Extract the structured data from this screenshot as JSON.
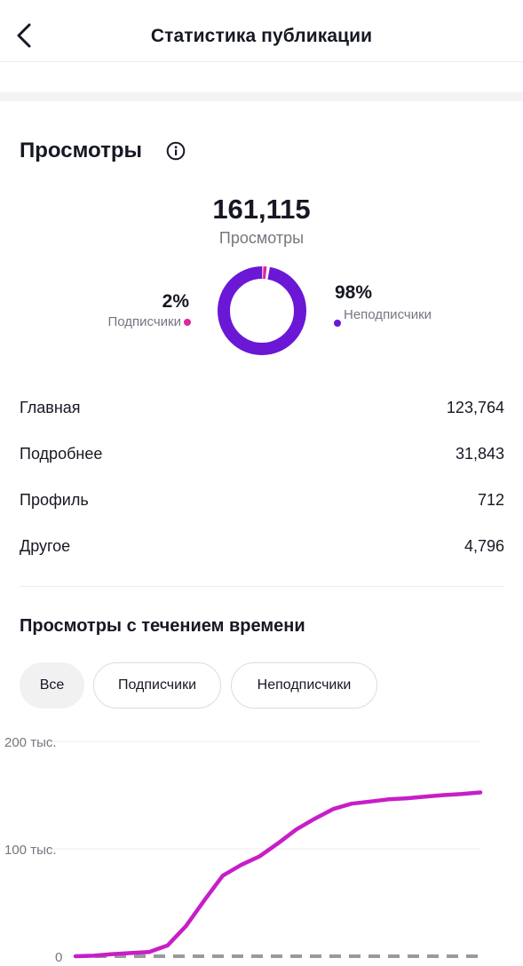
{
  "header": {
    "title": "Статистика публикации"
  },
  "views": {
    "title": "Просмотры",
    "total": "161,115",
    "total_label": "Просмотры",
    "subscribers": {
      "percent": "2%",
      "label": "Подписчики",
      "fraction": 0.02,
      "color": "#e0279b"
    },
    "non_subscribers": {
      "percent": "98%",
      "label": "Неподписчики",
      "fraction": 0.98,
      "color": "#6a17d6"
    }
  },
  "sources": [
    {
      "label": "Главная",
      "value": "123,764"
    },
    {
      "label": "Подробнее",
      "value": "31,843"
    },
    {
      "label": "Профиль",
      "value": "712"
    },
    {
      "label": "Другое",
      "value": "4,796"
    }
  ],
  "over_time": {
    "title": "Просмотры с течением времени",
    "filters": [
      "Все",
      "Подписчики",
      "Неподписчики"
    ],
    "selected_filter": "Все"
  },
  "chart_data": {
    "type": "line",
    "y_ticks": [
      "200 тыс.",
      "100 тыс.",
      "0"
    ],
    "ylim": [
      0,
      200000
    ],
    "grid": true,
    "series": [
      {
        "values": [
          0,
          500,
          2000,
          3000,
          4000,
          10000,
          28000,
          52000,
          75000,
          85000,
          93000,
          105000,
          118000,
          128000,
          137000,
          142000,
          144000,
          146000,
          147000,
          148500,
          150000,
          151000,
          152500
        ],
        "color": "#c71ec8",
        "style": "solid"
      },
      {
        "values": [
          0,
          0,
          0,
          0,
          0,
          0,
          0,
          0,
          0,
          0,
          0,
          0,
          0,
          0,
          0,
          0,
          0,
          0,
          0,
          0,
          0,
          0,
          0
        ],
        "color": "#9a9a9e",
        "style": "dashed"
      }
    ]
  }
}
